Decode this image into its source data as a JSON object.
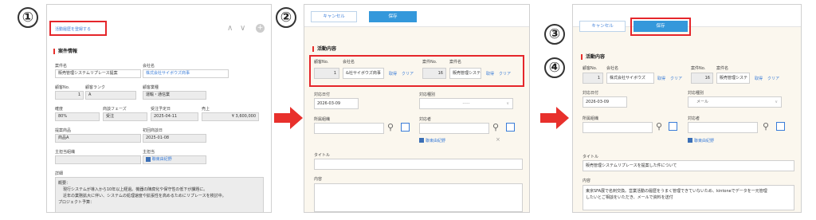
{
  "steps": [
    "①",
    "②",
    "③",
    "④"
  ],
  "colors": {
    "accent_blue": "#3498db",
    "highlight_red": "#e5262b",
    "arrow_red": "#e8302c"
  },
  "panel1": {
    "register_link": "活動履歴を登録する",
    "section_title": "案件情報",
    "labels": {
      "deal_name": "案件名",
      "company_name": "会社名",
      "customer_no": "顧客No.",
      "customer_rank": "顧客ランク",
      "industry": "顧客業種",
      "probability": "確度",
      "phase": "商談フェーズ",
      "order_date": "受注予定日",
      "sales": "売上",
      "product": "提案商品",
      "first_visit": "初回商談日",
      "dept": "主担当組織",
      "owner": "主担当",
      "detail": "詳細"
    },
    "values": {
      "deal_name": "販売管理システムリプレース提案",
      "company_name": "株式会社サイボウズ商事",
      "customer_no": "1",
      "customer_rank": "A",
      "industry": "運輸・通信業",
      "probability": "80%",
      "phase": "受注",
      "order_date": "2025-04-11",
      "sales": "¥ 3,600,000",
      "product": "商品A",
      "first_visit": "2025-01-08",
      "owner": "聯東由紀野"
    },
    "detail_lines": [
      "概要：",
      "現行システムが導入から10年以上経過。機器の陳腐化や保守性の低下が課題に。",
      "近年の業務拡大に伴い、システムの処理速度や拡張性を高めるためにリプレースを検討中。",
      "",
      "プロジェクト予算："
    ]
  },
  "panel2": {
    "cancel": "キャンセル",
    "save": "保存",
    "section_title": "活動内容",
    "labels": {
      "customer_no": "顧客No.",
      "company_name": "会社名",
      "deal_no": "案件No.",
      "deal_name": "案件名",
      "date": "対応日付",
      "type": "対応種別",
      "dept": "所属組織",
      "person": "対応者",
      "title": "タイトル",
      "content": "内容"
    },
    "values": {
      "customer_no": "1",
      "company_name": "&社サイボウズ商事",
      "deal_no": "16",
      "deal_name": "販売管理システ",
      "date": "2026-03-09",
      "type": "-----",
      "person": "聯東由紀野"
    },
    "get": "取得",
    "clear": "クリア"
  },
  "panel3": {
    "cancel": "キャンセル",
    "save": "保存",
    "section_title": "活動内容",
    "labels": {
      "customer_no": "顧客No.",
      "company_name": "会社名",
      "deal_no": "案件No.",
      "deal_name": "案件名",
      "date": "対応日付",
      "type": "対応種別",
      "dept": "所属組織",
      "person": "対応者",
      "title": "タイトル",
      "content": "内容"
    },
    "values": {
      "customer_no": "1",
      "company_name": "株式会社サイボウズ",
      "deal_no": "16",
      "deal_name": "販売管理システ",
      "date": "2026-03-09",
      "type": "メール",
      "person": "聯東由紀野",
      "title": "販売管理システムリプレースを提案した件について",
      "content_1": "東京SFA展で名刺交換。営業活動の履歴をうまく管理できていないため、kintoneでデータを一元管理",
      "content_2": "したいとご相談をいただき、メールで資料を送付"
    },
    "get": "取得",
    "clear": "クリア"
  }
}
